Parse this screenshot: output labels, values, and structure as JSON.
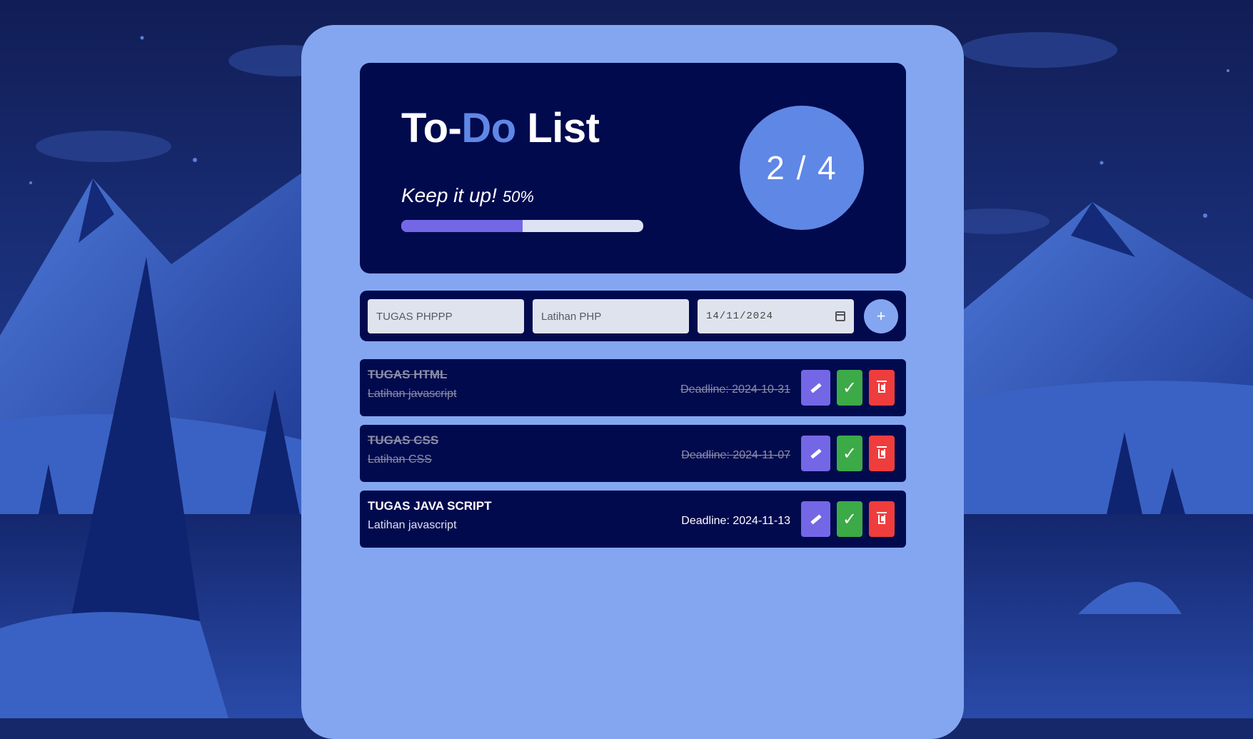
{
  "colors": {
    "card_background": "#84a6f0",
    "panel_background": "#020a4e",
    "accent": "#5f87e6",
    "progress_fill": "#7467e6",
    "edit_button": "#7467e6",
    "complete_button": "#3caa47",
    "delete_button": "#ef3d3d"
  },
  "header": {
    "title_prefix": "To-",
    "title_accent": "Do",
    "title_suffix": " List",
    "motto": "Keep it up!",
    "percent_text": "50%",
    "progress_fraction": 0.5,
    "counter": "2 / 4"
  },
  "form": {
    "task_name_value": "TUGAS PHPPP",
    "task_desc_value": "Latihan PHP",
    "date_value": "14/11/2024",
    "date_icon": "calendar-icon",
    "add_label": "+"
  },
  "tasks": [
    {
      "name": "TUGAS HTML",
      "desc": "Latihan javascript",
      "deadline": "Deadline: 2024-10-31",
      "completed": true
    },
    {
      "name": "TUGAS CSS",
      "desc": "Latihan CSS",
      "deadline": "Deadline: 2024-11-07",
      "completed": true
    },
    {
      "name": "TUGAS JAVA SCRIPT",
      "desc": "Latihan javascript",
      "deadline": "Deadline: 2024-11-13",
      "completed": false
    }
  ],
  "task_actions": {
    "edit_icon": "pencil-icon",
    "complete_label": "✓",
    "delete_icon": "trash-icon"
  }
}
